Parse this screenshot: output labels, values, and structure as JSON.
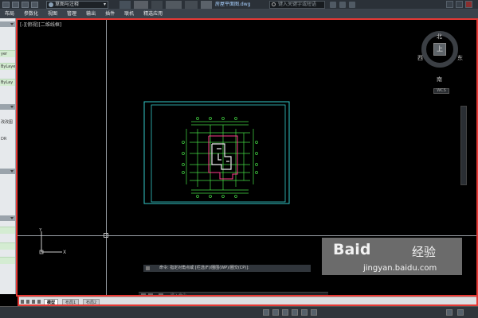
{
  "titlebar": {
    "workspace": "草图与注释",
    "document_title": "房屋平面图.dwg",
    "search_placeholder": "键入关键字或短语"
  },
  "menu": [
    "布局",
    "参数化",
    "视图",
    "管理",
    "输出",
    "插件",
    "联机",
    "精选应用"
  ],
  "left_panel": {
    "rows": [
      "yer",
      "ByLayer",
      "ByLay",
      "改改图",
      "DR"
    ]
  },
  "viewport": {
    "label": "[-][俯视][二维线框]"
  },
  "compass": {
    "north": "北",
    "south": "南",
    "east": "东",
    "west": "西",
    "top": "上",
    "wcs": "WCS"
  },
  "command": {
    "history": "命令: 指定对角点或 [栏选(F)/圈围(WP)/圈交(CP)]:",
    "placeholder": "键入命令"
  },
  "tabs": [
    "模型",
    "布局1",
    "布局2"
  ],
  "active_tab": 0,
  "watermark": {
    "brand": "Baid",
    "cn": "经验",
    "url": "jingyan.baidu.com"
  },
  "colors": {
    "highlight_red": "#e53935",
    "cyan": "#35c7c7",
    "green": "#44dd44",
    "magenta": "#ff3a8c"
  }
}
